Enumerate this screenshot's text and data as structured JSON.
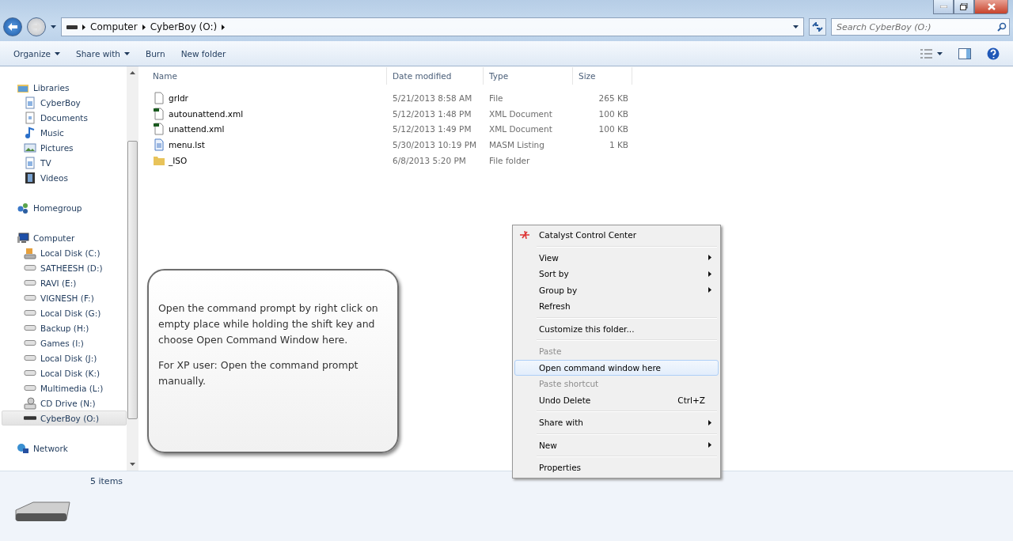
{
  "address_bar": {
    "crumbs": [
      "Computer",
      "CyberBoy (O:)"
    ]
  },
  "search": {
    "placeholder": "Search CyberBoy (O:)"
  },
  "toolbar": {
    "buttons": [
      {
        "label": "Organize",
        "dropdown": true
      },
      {
        "label": "Share with",
        "dropdown": true
      },
      {
        "label": "Burn",
        "dropdown": false
      },
      {
        "label": "New folder",
        "dropdown": false
      }
    ]
  },
  "sidebar": {
    "sections": [
      {
        "label": "Libraries",
        "kind": "library",
        "selected": false,
        "children": [
          {
            "label": "CyberBoy",
            "kind": "doclib",
            "selected": false
          },
          {
            "label": "Documents",
            "kind": "document",
            "selected": false
          },
          {
            "label": "Music",
            "kind": "music",
            "selected": false
          },
          {
            "label": "Pictures",
            "kind": "picture",
            "selected": false
          },
          {
            "label": "TV",
            "kind": "doclib",
            "selected": false
          },
          {
            "label": "Videos",
            "kind": "video",
            "selected": false
          }
        ]
      },
      {
        "label": "Homegroup",
        "kind": "homegroup",
        "selected": false
      },
      {
        "label": "Computer",
        "kind": "computer",
        "selected": false,
        "children": [
          {
            "label": "Local Disk (C:)",
            "kind": "system",
            "selected": false
          },
          {
            "label": "SATHEESH (D:)",
            "kind": "drive",
            "selected": false
          },
          {
            "label": "RAVI (E:)",
            "kind": "drive",
            "selected": false
          },
          {
            "label": "VIGNESH (F:)",
            "kind": "drive",
            "selected": false
          },
          {
            "label": "Local Disk (G:)",
            "kind": "drive",
            "selected": false
          },
          {
            "label": "Backup (H:)",
            "kind": "drive",
            "selected": false
          },
          {
            "label": "Games (I:)",
            "kind": "drive",
            "selected": false
          },
          {
            "label": "Local Disk (J:)",
            "kind": "drive",
            "selected": false
          },
          {
            "label": "Local Disk (K:)",
            "kind": "drive",
            "selected": false
          },
          {
            "label": "Multimedia (L:)",
            "kind": "drive",
            "selected": false
          },
          {
            "label": "CD Drive (N:)",
            "kind": "cd",
            "selected": false
          },
          {
            "label": "CyberBoy (O:)",
            "kind": "usb",
            "selected": true
          }
        ]
      },
      {
        "label": "Network",
        "kind": "network",
        "selected": false
      }
    ]
  },
  "file_list": {
    "columns": [
      "Name",
      "Date modified",
      "Type",
      "Size"
    ],
    "rows": [
      {
        "name": "grldr",
        "date": "5/21/2013 8:58 AM",
        "type": "File",
        "size": "265 KB",
        "kind": "file"
      },
      {
        "name": "autounattend.xml",
        "date": "5/12/2013 1:48 PM",
        "type": "XML Document",
        "size": "100 KB",
        "kind": "xml"
      },
      {
        "name": "unattend.xml",
        "date": "5/12/2013 1:49 PM",
        "type": "XML Document",
        "size": "100 KB",
        "kind": "xml"
      },
      {
        "name": "menu.lst",
        "date": "5/30/2013 10:19 PM",
        "type": "MASM Listing",
        "size": "1 KB",
        "kind": "text"
      },
      {
        "name": "_ISO",
        "date": "6/8/2013 5:20 PM",
        "type": "File folder",
        "size": "",
        "kind": "folder"
      }
    ]
  },
  "callout": {
    "paragraphs": [
      "Open the command prompt by right click on empty place while holding the shift key and choose Open Command Window here.",
      "For XP user: Open the command prompt manually."
    ]
  },
  "context_menu": {
    "groups": [
      [
        {
          "label": "Catalyst Control Center",
          "disabled": false,
          "selected": false,
          "submenu": false,
          "icon": true
        }
      ],
      [
        {
          "label": "View",
          "disabled": false,
          "selected": false,
          "submenu": true,
          "icon": false
        },
        {
          "label": "Sort by",
          "disabled": false,
          "selected": false,
          "submenu": true,
          "icon": false
        },
        {
          "label": "Group by",
          "disabled": false,
          "selected": false,
          "submenu": true,
          "icon": false
        },
        {
          "label": "Refresh",
          "disabled": false,
          "selected": false,
          "submenu": false,
          "icon": false
        }
      ],
      [
        {
          "label": "Customize this folder...",
          "disabled": false,
          "selected": false,
          "submenu": false,
          "icon": false
        }
      ],
      [
        {
          "label": "Paste",
          "disabled": true,
          "selected": false,
          "submenu": false,
          "icon": false
        },
        {
          "label": "Open command window here",
          "disabled": false,
          "selected": true,
          "submenu": false,
          "icon": false
        },
        {
          "label": "Paste shortcut",
          "disabled": true,
          "selected": false,
          "submenu": false,
          "icon": false
        },
        {
          "label": "Undo Delete",
          "shortcut": "Ctrl+Z",
          "disabled": false,
          "selected": false,
          "submenu": false,
          "icon": false
        }
      ],
      [
        {
          "label": "Share with",
          "disabled": false,
          "selected": false,
          "submenu": true,
          "icon": false
        }
      ],
      [
        {
          "label": "New",
          "disabled": false,
          "selected": false,
          "submenu": true,
          "icon": false
        }
      ],
      [
        {
          "label": "Properties",
          "disabled": false,
          "selected": false,
          "submenu": false,
          "icon": false
        }
      ]
    ]
  },
  "status": {
    "count": "5 items"
  }
}
